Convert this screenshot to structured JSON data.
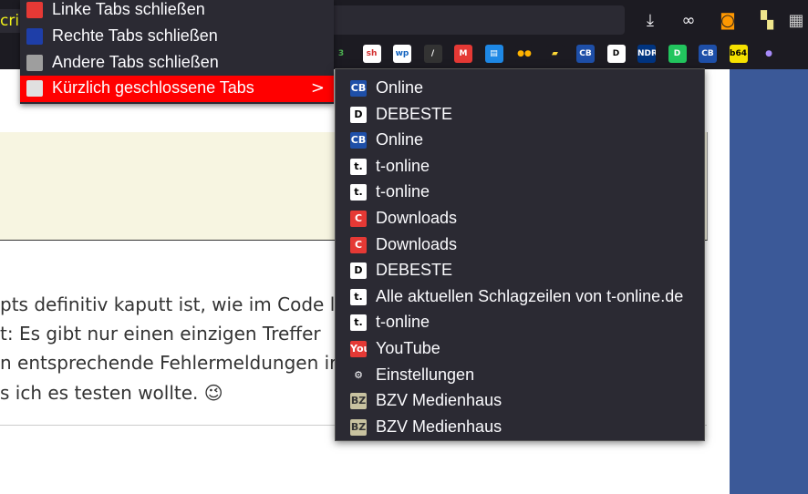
{
  "browser": {
    "url_fragment": "crip",
    "bookmarks": [
      {
        "icon": "bookmark-favicon-3",
        "text": "3",
        "color": "#1c1b22",
        "fg": "#4caf50"
      },
      {
        "icon": "bookmark-favicon-sh",
        "text": "sh",
        "color": "#ffffff",
        "fg": "#d32f2f"
      },
      {
        "icon": "bookmark-favicon-wp",
        "text": "wp",
        "color": "#ffffff",
        "fg": "#1565c0"
      },
      {
        "icon": "bookmark-favicon-pen",
        "text": "/",
        "color": "#333333",
        "fg": "#ffffff"
      },
      {
        "icon": "bookmark-favicon-m",
        "text": "M",
        "color": "#e53935",
        "fg": "#ffffff"
      },
      {
        "icon": "bookmark-favicon-chat",
        "text": "▤",
        "color": "#1e88e5",
        "fg": "#ffffff"
      },
      {
        "icon": "bookmark-favicon-dots",
        "text": "●●",
        "color": "#1c1b22",
        "fg": "#ffb300"
      },
      {
        "icon": "bookmark-favicon-folder",
        "text": "▰",
        "color": "#1c1b22",
        "fg": "#fdd835"
      },
      {
        "icon": "bookmark-favicon-cb",
        "text": "CB",
        "color": "#1e4fa8",
        "fg": "#ffffff"
      },
      {
        "icon": "bookmark-favicon-d",
        "text": "D",
        "color": "#ffffff",
        "fg": "#000000"
      },
      {
        "icon": "bookmark-favicon-ndr",
        "text": "NDR",
        "color": "#003480",
        "fg": "#ffffff"
      },
      {
        "icon": "bookmark-favicon-d-green",
        "text": "D",
        "color": "#22c55e",
        "fg": "#ffffff"
      },
      {
        "icon": "bookmark-favicon-cb2",
        "text": "CB",
        "color": "#1e4fa8",
        "fg": "#ffffff"
      },
      {
        "icon": "bookmark-favicon-b64",
        "text": "b64",
        "color": "#f5e100",
        "fg": "#000000"
      },
      {
        "icon": "bookmark-favicon-pin",
        "text": "●",
        "color": "#1c1b22",
        "fg": "#a78bfa"
      }
    ]
  },
  "context_menu": {
    "items": [
      {
        "label": "Linke Tabs schließen",
        "icon": "close-left-tabs-icon",
        "icon_color": "#e53935"
      },
      {
        "label": "Rechte Tabs schließen",
        "icon": "close-right-tabs-icon",
        "icon_color": "#1e3ea8"
      },
      {
        "label": "Andere Tabs schließen",
        "icon": "close-other-tabs-icon",
        "icon_color": "#9e9e9e"
      },
      {
        "label": "Kürzlich geschlossene Tabs",
        "icon": "recently-closed-tabs-icon",
        "icon_color": "#e0e0e0",
        "chevron": ">"
      }
    ]
  },
  "submenu": {
    "items": [
      {
        "label": "Online",
        "icon": "cb-favicon",
        "badge": "CB",
        "bg": "#1e4fa8",
        "fg": "#ffffff"
      },
      {
        "label": "DEBESTE",
        "icon": "debeste-favicon",
        "badge": "D",
        "bg": "#ffffff",
        "fg": "#000000"
      },
      {
        "label": "Online",
        "icon": "cb-favicon",
        "badge": "CB",
        "bg": "#1e4fa8",
        "fg": "#ffffff"
      },
      {
        "label": "t-online",
        "icon": "t-online-favicon",
        "badge": "t.",
        "bg": "#ffffff",
        "fg": "#000000"
      },
      {
        "label": "t-online",
        "icon": "t-online-favicon",
        "badge": "t.",
        "bg": "#ffffff",
        "fg": "#000000"
      },
      {
        "label": "Downloads",
        "icon": "downloads-favicon",
        "badge": "C",
        "bg": "#e53935",
        "fg": "#ffffff"
      },
      {
        "label": "Downloads",
        "icon": "downloads-favicon",
        "badge": "C",
        "bg": "#e53935",
        "fg": "#ffffff"
      },
      {
        "label": "DEBESTE",
        "icon": "debeste-favicon",
        "badge": "D",
        "bg": "#ffffff",
        "fg": "#000000"
      },
      {
        "label": "Alle aktuellen Schlagzeilen von t-online.de",
        "icon": "t-online-favicon",
        "badge": "t.",
        "bg": "#ffffff",
        "fg": "#000000"
      },
      {
        "label": "t-online",
        "icon": "t-online-favicon",
        "badge": "t.",
        "bg": "#ffffff",
        "fg": "#000000"
      },
      {
        "label": "YouTube",
        "icon": "youtube-favicon",
        "badge": "You",
        "bg": "#e53935",
        "fg": "#ffffff"
      },
      {
        "label": "Einstellungen",
        "icon": "gear-icon",
        "badge": "⚙",
        "bg": "#2b2a33",
        "fg": "#fbfbfe"
      },
      {
        "label": "BZV Medienhaus",
        "icon": "bzv-favicon",
        "badge": "BZ",
        "bg": "#c8c2a0",
        "fg": "#333333"
      },
      {
        "label": "BZV Medienhaus",
        "icon": "bzv-favicon",
        "badge": "BZ",
        "bg": "#c8c2a0",
        "fg": "#333333"
      }
    ]
  },
  "article": {
    "lines": [
      "pts definitiv kaputt ist, wie im Code l",
      "t: Es gibt nur einen einzigen Treffer",
      "n entsprechende Fehlermeldungen ir",
      "s ich es testen wollte. 😉"
    ]
  }
}
